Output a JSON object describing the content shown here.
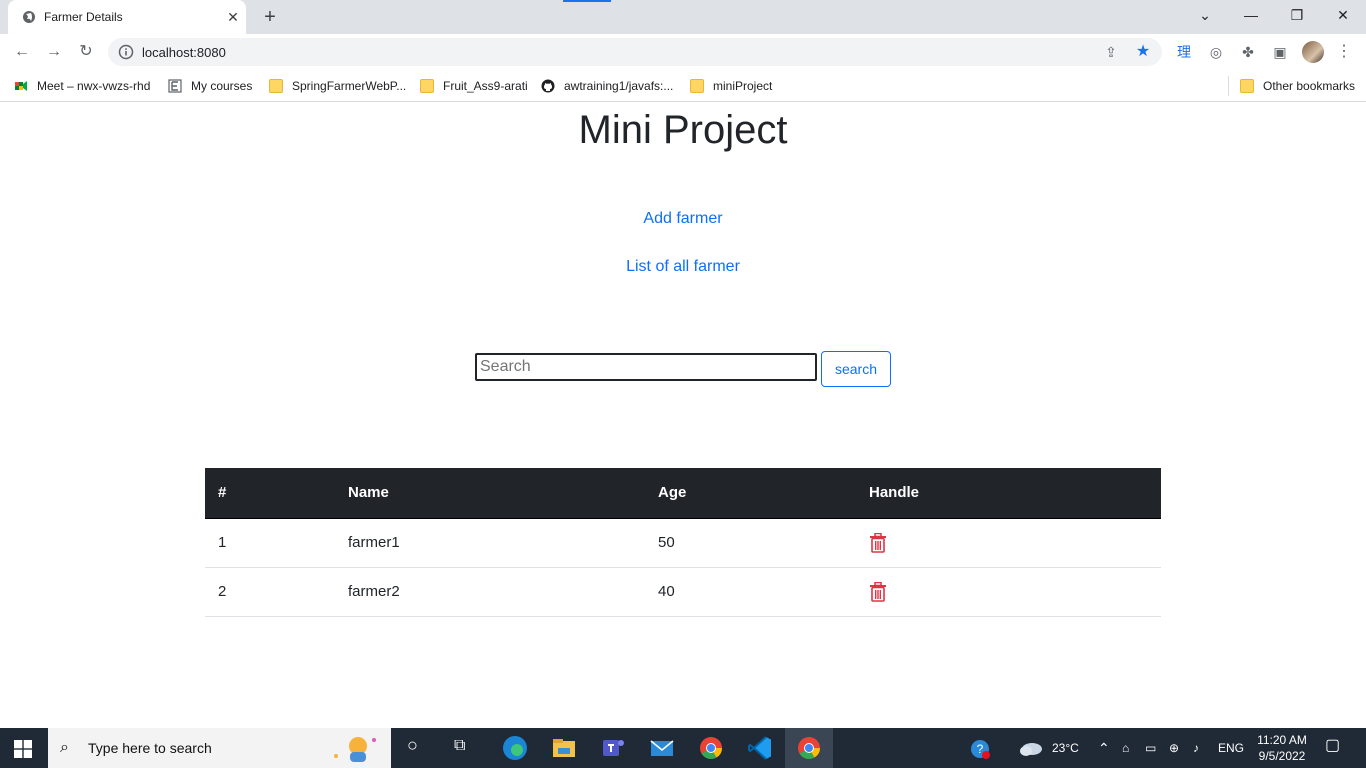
{
  "browser": {
    "tab_title": "Farmer Details",
    "url": "localhost:8080",
    "bookmarks": [
      {
        "label": "Meet – nwx-vwzs-rhd",
        "icon": "meet-icon"
      },
      {
        "label": "My courses",
        "icon": "moodle-icon"
      },
      {
        "label": "SpringFarmerWebP...",
        "icon": "folder-icon"
      },
      {
        "label": "Fruit_Ass9-arati",
        "icon": "folder-icon"
      },
      {
        "label": "awtraining1/javafs:...",
        "icon": "github-icon"
      },
      {
        "label": "miniProject",
        "icon": "folder-icon"
      }
    ],
    "other_bookmarks": "Other bookmarks",
    "extension_glyph": "理"
  },
  "page": {
    "title": "Mini Project",
    "add_link": "Add farmer",
    "list_link": "List of all farmer",
    "search": {
      "placeholder": "Search",
      "value": "",
      "button_label": "search"
    },
    "table": {
      "headers": [
        "#",
        "Name",
        "Age",
        "Handle"
      ],
      "rows": [
        {
          "id": "1",
          "name": "farmer1",
          "age": "50"
        },
        {
          "id": "2",
          "name": "farmer2",
          "age": "40"
        }
      ]
    },
    "colors": {
      "link": "#0d6efd",
      "header_bg": "#212529",
      "delete": "#dc3545"
    }
  },
  "taskbar": {
    "search_placeholder": "Type here to search",
    "weather": "23°C",
    "language": "ENG",
    "time": "11:20 AM",
    "date": "9/5/2022"
  }
}
